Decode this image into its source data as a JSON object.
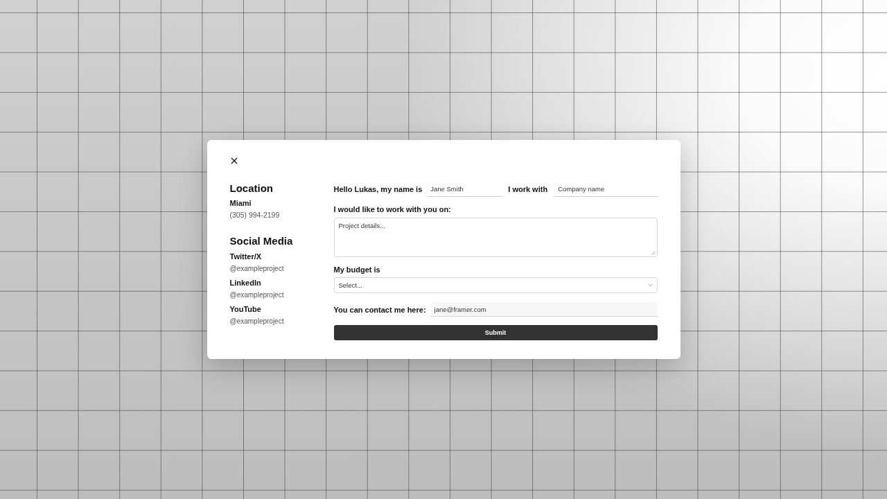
{
  "contact_info": {
    "location": {
      "heading": "Location",
      "city": "Miami",
      "phone": "(305) 994-2199"
    },
    "social": {
      "heading": "Social Media",
      "accounts": [
        {
          "network": "Twitter/X",
          "handle": "@exampleproject"
        },
        {
          "network": "LinkedIn",
          "handle": "@exampleproject"
        },
        {
          "network": "YouTube",
          "handle": "@exampleproject"
        }
      ]
    }
  },
  "form": {
    "name_label": "Hello Lukas, my name is",
    "name_field": {
      "placeholder": "Jane Smith"
    },
    "company_label": "I work with",
    "company_field": {
      "placeholder": "Company name"
    },
    "project_label": "I would like to work with you on:",
    "project_field": {
      "placeholder": "Project details..."
    },
    "budget_label": "My budget is",
    "budget_select": {
      "value": "Select..."
    },
    "contact_label": "You can contact me here:",
    "contact_field": {
      "placeholder": "jane@framer.com"
    },
    "submit": "Submit"
  }
}
